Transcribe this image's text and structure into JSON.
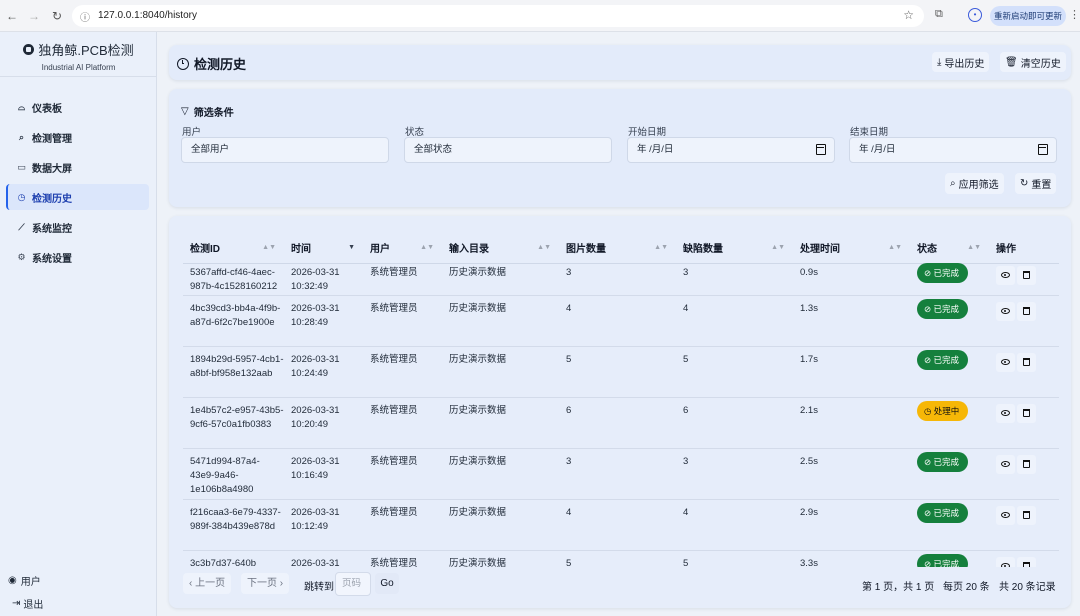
{
  "browser": {
    "url": "127.0.0.1:8040/history",
    "update_label": "重新启动即可更新"
  },
  "sidebar": {
    "brand": "独角鲸.PCB检测",
    "subtitle": "Industrial AI Platform",
    "items": [
      {
        "label": "仪表板",
        "icon": "dashboard-icon"
      },
      {
        "label": "检测管理",
        "icon": "search-icon"
      },
      {
        "label": "数据大屏",
        "icon": "monitor-icon"
      },
      {
        "label": "检测历史",
        "icon": "clock-icon",
        "active": true
      },
      {
        "label": "系统监控",
        "icon": "chart-line-icon"
      },
      {
        "label": "系统设置",
        "icon": "gear-icon"
      }
    ],
    "user_label": "用户",
    "logout_label": "退出"
  },
  "header": {
    "title": "检测历史",
    "export_label": "导出历史",
    "clear_label": "清空历史"
  },
  "filters": {
    "title": "筛选条件",
    "user": {
      "label": "用户",
      "value": "全部用户"
    },
    "status": {
      "label": "状态",
      "value": "全部状态"
    },
    "start_date": {
      "label": "开始日期",
      "value": "年 /月/日"
    },
    "end_date": {
      "label": "结束日期",
      "value": "年 /月/日"
    },
    "apply_label": "应用筛选",
    "reset_label": "重置"
  },
  "table": {
    "columns": [
      "检测ID",
      "时间",
      "用户",
      "输入目录",
      "图片数量",
      "缺陷数量",
      "处理时间",
      "状态",
      "操作"
    ],
    "rows": [
      {
        "id": "5367affd-cf46-4aec-987b-4c1528160212",
        "date": "2026-03-31",
        "time": "10:32:49",
        "user": "系统管理员",
        "dir": "历史演示数据",
        "images": "3",
        "defects": "3",
        "duration": "0.9s",
        "status": "已完成",
        "status_type": "done"
      },
      {
        "id": "4bc39cd3-bb4a-4f9b-a87d-6f2c7be1900e",
        "date": "2026-03-31",
        "time": "10:28:49",
        "user": "系统管理员",
        "dir": "历史演示数据",
        "images": "4",
        "defects": "4",
        "duration": "1.3s",
        "status": "已完成",
        "status_type": "done"
      },
      {
        "id": "1894b29d-5957-4cb1-a8bf-bf958e132aab",
        "date": "2026-03-31",
        "time": "10:24:49",
        "user": "系统管理员",
        "dir": "历史演示数据",
        "images": "5",
        "defects": "5",
        "duration": "1.7s",
        "status": "已完成",
        "status_type": "done"
      },
      {
        "id": "1e4b57c2-e957-43b5-9cf6-57c0a1fb0383",
        "date": "2026-03-31",
        "time": "10:20:49",
        "user": "系统管理员",
        "dir": "历史演示数据",
        "images": "6",
        "defects": "6",
        "duration": "2.1s",
        "status": "处理中",
        "status_type": "processing"
      },
      {
        "id": "5471d994-87a4-43e9-9a46-1e106b8a4980",
        "date": "2026-03-31",
        "time": "10:16:49",
        "user": "系统管理员",
        "dir": "历史演示数据",
        "images": "3",
        "defects": "3",
        "duration": "2.5s",
        "status": "已完成",
        "status_type": "done"
      },
      {
        "id": "f216caa3-6e79-4337-989f-384b439e878d",
        "date": "2026-03-31",
        "time": "10:12:49",
        "user": "系统管理员",
        "dir": "历史演示数据",
        "images": "4",
        "defects": "4",
        "duration": "2.9s",
        "status": "已完成",
        "status_type": "done"
      },
      {
        "id": "3c3b7d37-640b",
        "date": "2026-03-31",
        "time": "",
        "user": "系统管理员",
        "dir": "历史演示数据",
        "images": "5",
        "defects": "5",
        "duration": "3.3s",
        "status": "已完成",
        "status_type": "done"
      }
    ]
  },
  "pagination": {
    "prev_label": "上一页",
    "next_label": "下一页",
    "jump_label": "跳转到",
    "page_placeholder": "页码",
    "go_label": "Go",
    "page_info": "第 1 页，共 1 页",
    "per_page": "每页 20 条",
    "total": "共 20 条记录"
  }
}
